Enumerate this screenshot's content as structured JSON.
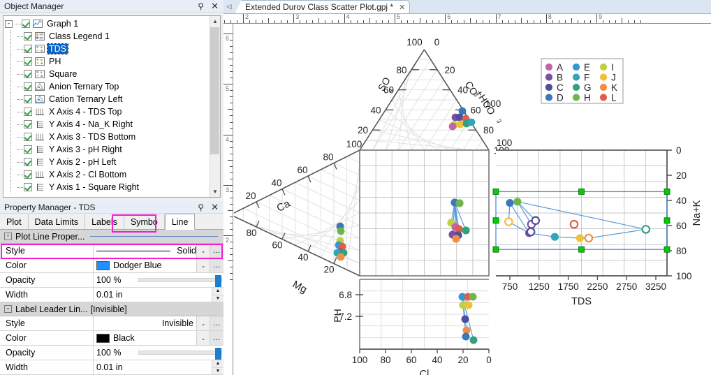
{
  "object_manager": {
    "title": "Object Manager",
    "pin_icon": "pin-icon",
    "close_icon": "close-icon",
    "tree": [
      {
        "label": "Graph 1",
        "depth": 0,
        "icon": "graph-icon",
        "checked": true,
        "expander": "-",
        "selected": false
      },
      {
        "label": "Class Legend 1",
        "depth": 1,
        "icon": "legend-icon",
        "checked": true,
        "selected": false
      },
      {
        "label": "TDS",
        "depth": 1,
        "icon": "scatter-icon",
        "checked": true,
        "selected": true
      },
      {
        "label": "PH",
        "depth": 1,
        "icon": "scatter-icon",
        "checked": true,
        "selected": false
      },
      {
        "label": "Square",
        "depth": 1,
        "icon": "scatter-icon",
        "checked": true,
        "selected": false
      },
      {
        "label": "Anion Ternary Top",
        "depth": 1,
        "icon": "ternary-icon",
        "checked": true,
        "selected": false
      },
      {
        "label": "Cation Ternary Left",
        "depth": 1,
        "icon": "ternary-icon",
        "checked": true,
        "selected": false
      },
      {
        "label": "X Axis 4 - TDS Top",
        "depth": 1,
        "icon": "x-axis-icon",
        "checked": true,
        "selected": false
      },
      {
        "label": "Y Axis 4 - Na_K Right",
        "depth": 1,
        "icon": "y-axis-icon",
        "checked": true,
        "selected": false
      },
      {
        "label": "X Axis 3 - TDS Bottom",
        "depth": 1,
        "icon": "x-axis-icon",
        "checked": true,
        "selected": false
      },
      {
        "label": "Y Axis 3 - pH Right",
        "depth": 1,
        "icon": "y-axis-icon",
        "checked": true,
        "selected": false
      },
      {
        "label": "Y Axis 2 - pH Left",
        "depth": 1,
        "icon": "y-axis-icon",
        "checked": true,
        "selected": false
      },
      {
        "label": "X Axis 2 - Cl Bottom",
        "depth": 1,
        "icon": "x-axis-icon",
        "checked": true,
        "selected": false
      },
      {
        "label": "Y Axis 1 - Square Right",
        "depth": 1,
        "icon": "y-axis-icon",
        "checked": true,
        "selected": false
      }
    ]
  },
  "property_manager": {
    "title": "Property Manager - TDS",
    "pin_icon": "pin-icon",
    "close_icon": "close-icon",
    "tabs": [
      {
        "label": "Plot",
        "active": false
      },
      {
        "label": "Data Limits",
        "active": false
      },
      {
        "label": "Labels",
        "active": false
      },
      {
        "label": "Symbo",
        "active": false
      },
      {
        "label": "Line",
        "active": true
      }
    ],
    "highlight_color": "#f020d0",
    "groups": [
      {
        "name": "Plot Line Proper...",
        "value": "",
        "rows": [
          {
            "label": "Style",
            "value": "Solid",
            "kind": "line-dropdown"
          },
          {
            "label": "Color",
            "value": "Dodger Blue",
            "kind": "color-dropdown",
            "swatch": "#1e90ff"
          },
          {
            "label": "Opacity",
            "value": "100 %",
            "kind": "slider"
          },
          {
            "label": "Width",
            "value": "0.01 in",
            "kind": "spinner"
          }
        ]
      },
      {
        "name": "Label Leader Lin...",
        "value": "[Invisible]",
        "rows": [
          {
            "label": "Style",
            "value": "Invisible",
            "kind": "dropdown"
          },
          {
            "label": "Color",
            "value": "Black",
            "kind": "color-dropdown",
            "swatch": "#000000"
          },
          {
            "label": "Opacity",
            "value": "100 %",
            "kind": "slider"
          },
          {
            "label": "Width",
            "value": "0.01 in",
            "kind": "spinner"
          }
        ]
      }
    ]
  },
  "document": {
    "tab_label": "Extended Durov Class Scatter Plot.gpj *",
    "tab_close_icon": "close-icon",
    "tab_scroll_icon": "chevron-left-icon",
    "ruler_h_labels": [
      "2",
      "3",
      "4",
      "5",
      "6",
      "7",
      "8",
      "9"
    ],
    "ruler_v_labels": [
      "6",
      "5",
      "4",
      "3",
      "2"
    ]
  },
  "chart_data": {
    "type": "scatter",
    "title": "Extended Durov Class Scatter Plot",
    "legend": {
      "position": "top-right",
      "entries": [
        {
          "label": "A",
          "color": "#c364a8"
        },
        {
          "label": "B",
          "color": "#7b4f9d"
        },
        {
          "label": "C",
          "color": "#4a4f9e"
        },
        {
          "label": "D",
          "color": "#3b77bd"
        },
        {
          "label": "E",
          "color": "#3397d4"
        },
        {
          "label": "F",
          "color": "#2fa6ba"
        },
        {
          "label": "G",
          "color": "#35a07e"
        },
        {
          "label": "H",
          "color": "#6fb54a"
        },
        {
          "label": "I",
          "color": "#bfd140"
        },
        {
          "label": "J",
          "color": "#f0bf3e"
        },
        {
          "label": "K",
          "color": "#ef8f46"
        },
        {
          "label": "L",
          "color": "#e05c4d"
        }
      ]
    },
    "panels": [
      {
        "name": "anion-ternary-top",
        "type": "ternary",
        "axes": [
          {
            "label": "SO4",
            "ticks": [
              "100",
              "80",
              "60",
              "40",
              "20"
            ]
          },
          {
            "label": "CO3+HCO3",
            "ticks": [
              "0",
              "20",
              "40",
              "60",
              "80",
              "100"
            ]
          },
          {
            "label": "Cl",
            "ticks": [
              "100",
              "80",
              "60",
              "40",
              "20",
              "0"
            ]
          }
        ]
      },
      {
        "name": "cation-ternary-left",
        "type": "ternary",
        "axes": [
          {
            "label": "Ca",
            "ticks": [
              "100",
              "80",
              "60",
              "40",
              "20",
              "0"
            ]
          },
          {
            "label": "Mg",
            "ticks": [
              "100",
              "80",
              "60",
              "40",
              "20"
            ]
          },
          {
            "label": "Na+K",
            "ticks": [
              "0",
              "20",
              "40",
              "60",
              "80",
              "100"
            ]
          }
        ]
      },
      {
        "name": "center-square",
        "type": "scatter",
        "xlabel": "Cl",
        "ylabel": "Na+K",
        "grid": true
      },
      {
        "name": "ph-vs-cl",
        "type": "scatter",
        "xlabel": "Cl",
        "ylabel": "PH",
        "xticks": [
          "100",
          "80",
          "60",
          "40",
          "20",
          "0"
        ],
        "yticks": [
          "6.8",
          "7.2"
        ]
      },
      {
        "name": "tds-vs-nak",
        "type": "scatter",
        "xlabel": "TDS",
        "ylabel": "Na+K",
        "xticks": [
          "750",
          "1250",
          "1750",
          "2250",
          "2750",
          "3250"
        ],
        "yticks": [
          "0",
          "20",
          "40",
          "60",
          "80",
          "100"
        ],
        "xlim": [
          500,
          3500
        ],
        "ylim": [
          0,
          100
        ],
        "selected": true,
        "selection_handle_color": "#00d000",
        "points": [
          {
            "x": 750,
            "y": 42,
            "color": "#3b77bd",
            "filled": true
          },
          {
            "x": 880,
            "y": 41,
            "color": "#6fb54a",
            "filled": true
          },
          {
            "x": 730,
            "y": 57,
            "color": "#f0bf3e",
            "filled": false
          },
          {
            "x": 1120,
            "y": 59,
            "color": "#7b4f9d",
            "filled": false
          },
          {
            "x": 1190,
            "y": 56,
            "color": "#4a4f9e",
            "filled": false
          },
          {
            "x": 1080,
            "y": 66,
            "color": "#7b4f9d",
            "filled": true
          },
          {
            "x": 1110,
            "y": 65,
            "color": "#4a4f9e",
            "filled": false
          },
          {
            "x": 1520,
            "y": 69,
            "color": "#2fa6ba",
            "filled": true
          },
          {
            "x": 1850,
            "y": 59,
            "color": "#e05c4d",
            "filled": false
          },
          {
            "x": 1950,
            "y": 70,
            "color": "#f0bf3e",
            "filled": true
          },
          {
            "x": 2100,
            "y": 70,
            "color": "#ef8f46",
            "filled": false
          },
          {
            "x": 3080,
            "y": 63,
            "color": "#35a07e",
            "filled": false
          }
        ]
      }
    ]
  }
}
